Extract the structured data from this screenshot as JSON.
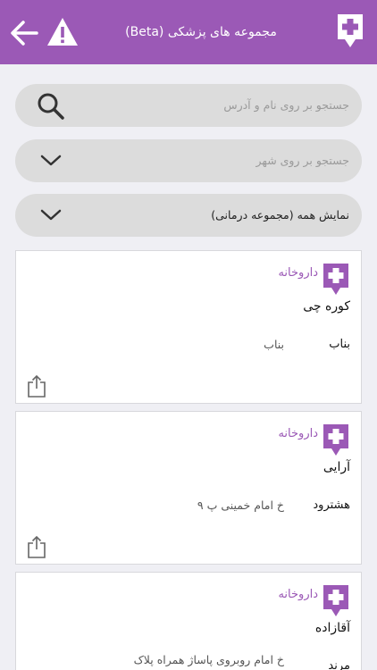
{
  "header": {
    "title": "مجموعه  های پزشکی (Beta)",
    "back_icon": "arrow-left-icon",
    "warning_icon": "warning-icon",
    "logo_icon": "medical-plus-icon",
    "color": "#9b59b6"
  },
  "search": {
    "placeholder": "جستجو بر روی نام و آدرس",
    "icon": "search-icon"
  },
  "city_filter": {
    "placeholder": "جستجو بر روی شهر",
    "icon": "chevron-down-icon"
  },
  "type_filter": {
    "selected": "نمایش همه (مجموعه درمانی)",
    "icon": "chevron-down-icon"
  },
  "results": [
    {
      "category": "داروخانه",
      "name": "کوره چی",
      "city": "بناب",
      "address": "بناب"
    },
    {
      "category": "داروخانه",
      "name": "آرایی",
      "city": "هشترود",
      "address": "خ امام خمینی  پ ۹"
    },
    {
      "category": "داروخانه",
      "name": "آقازاده",
      "city": "مرند",
      "address": "خ امام   روبروی پاساژ همراه  پلاک"
    }
  ],
  "colors": {
    "accent": "#9b59b6",
    "background": "#efeff4",
    "field": "#dcdcdc"
  }
}
